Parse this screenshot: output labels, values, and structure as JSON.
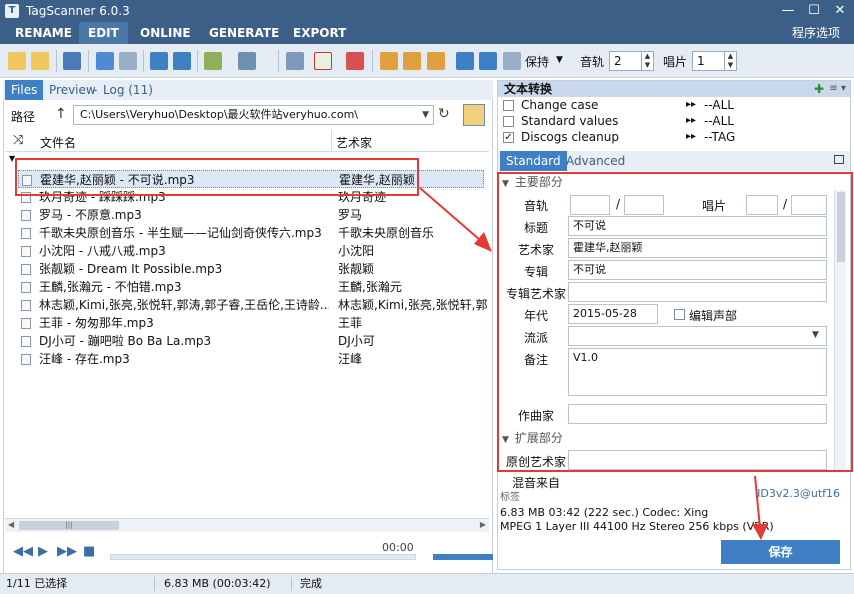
{
  "window": {
    "title": "TagScanner 6.0.3"
  },
  "menu": {
    "tabs": [
      "RENAME",
      "EDIT",
      "ONLINE",
      "GENERATE",
      "EXPORT"
    ],
    "options": "程序选项"
  },
  "toolbar": {
    "keep_label": "保持",
    "track_label": "音轨",
    "track_value": "2",
    "disc_label": "唱片",
    "disc_value": "1"
  },
  "left": {
    "tabs": {
      "files": "Files",
      "preview": "Preview",
      "log": "Log (11)",
      "sep": "-"
    },
    "path_label": "路径",
    "path_value": "C:\\Users\\Veryhuo\\Desktop\\最火软件站veryhuo.com\\",
    "columns": {
      "filename": "文件名",
      "artist": "艺术家"
    },
    "rows": [
      {
        "file": "霍建华,赵丽颖 - 不可说.mp3",
        "artist": "霍建华,赵丽颖"
      },
      {
        "file": "玖月奇迹 - 踩踩踩.mp3",
        "artist": "玖月奇迹"
      },
      {
        "file": "罗马 - 不原意.mp3",
        "artist": "罗马"
      },
      {
        "file": "千歌未央原创音乐 - 半生赋——记仙剑奇侠传六.mp3",
        "artist": "千歌未央原创音乐"
      },
      {
        "file": "小沈阳 - 八戒八戒.mp3",
        "artist": "小沈阳"
      },
      {
        "file": "张靓颖 - Dream It Possible.mp3",
        "artist": "张靓颖"
      },
      {
        "file": "王麟,张瀚元 - 不怕错.mp3",
        "artist": "王麟,张瀚元"
      },
      {
        "file": "林志颖,Kimi,张亮,张悦轩,郭涛,郭子睿,王岳伦,王诗龄...",
        "artist": "林志颖,Kimi,张亮,张悦轩,郭..."
      },
      {
        "file": "王菲 - 匆匆那年.mp3",
        "artist": "王菲"
      },
      {
        "file": "DJ小可 - 蹦吧啦 Bo Ba La.mp3",
        "artist": "DJ小可"
      },
      {
        "file": "汪峰 - 存在.mp3",
        "artist": "汪峰"
      }
    ],
    "player_time": "00:00"
  },
  "right": {
    "text_convert_title": "文本转换",
    "text_convert": [
      {
        "name": "Change case",
        "value": "--ALL",
        "checked": false
      },
      {
        "name": "Standard values",
        "value": "--ALL",
        "checked": false
      },
      {
        "name": "Discogs cleanup",
        "value": "--TAG",
        "checked": true
      }
    ],
    "subtabs": [
      "Standard",
      "Advanced"
    ],
    "main_section": "主要部分",
    "ext_section": "扩展部分",
    "fields": {
      "track_label": "音轨",
      "disc_label": "唱片",
      "title_label": "标题",
      "title_value": "不可说",
      "artist_label": "艺术家",
      "artist_value": "霍建华,赵丽颖",
      "album_label": "专辑",
      "album_value": "不可说",
      "album_artist_label": "专辑艺术家",
      "album_artist_value": "",
      "year_label": "年代",
      "year_value": "2015-05-28",
      "edit_voice_label": "编辑声部",
      "genre_label": "流派",
      "genre_value": "",
      "comment_label": "备注",
      "comment_value": "V1.0",
      "composer_label": "作曲家",
      "composer_value": "",
      "orig_artist_label": "原创艺术家",
      "orig_artist_value": "",
      "remix_label": "混音来自"
    },
    "tags_label": "标签",
    "tag_version": "ID3v2.3@utf16",
    "info_line1": "6.83 MB  03:42 (222 sec.)  Codec: Xing",
    "info_line2": "MPEG 1 Layer III  44100 Hz  Stereo  256 kbps (VBR)",
    "save_label": "保存"
  },
  "status": {
    "selected": "1/11 已选择",
    "size": "6.83 MB (00:03:42)",
    "done": "完成"
  },
  "colors": {
    "accent": "#3f7fc4",
    "titlebar": "#3b5f86",
    "highlight": "#e53935"
  }
}
